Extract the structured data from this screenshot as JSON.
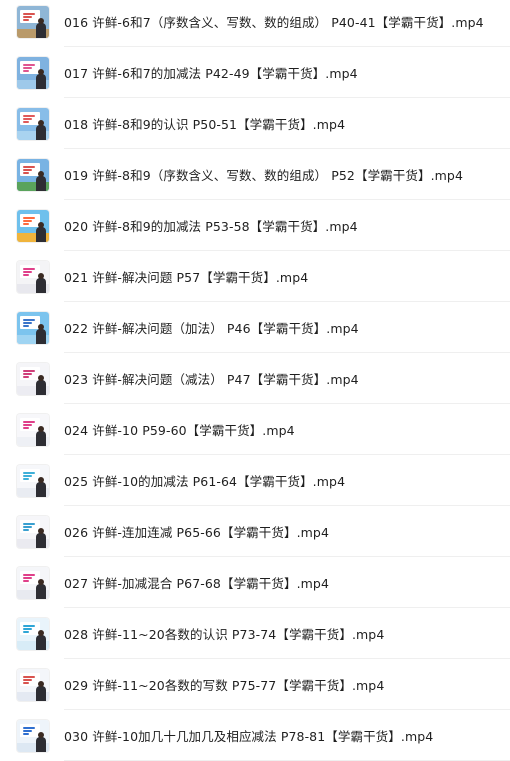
{
  "files": [
    {
      "name": "016 许鲜-6和7（序数含义、写数、数的组成） P40-41【学霸干货】.mp4",
      "thumb": {
        "sky": "#8fb6d6",
        "ground": "#b99a6a",
        "accent": "#d9534f"
      }
    },
    {
      "name": "017 许鲜-6和7的加减法 P42-49【学霸干货】.mp4",
      "thumb": {
        "sky": "#7fb2e0",
        "ground": "#9ec9ea",
        "accent": "#e0558f"
      }
    },
    {
      "name": "018 许鲜-8和9的认识 P50-51【学霸干货】.mp4",
      "thumb": {
        "sky": "#88bde8",
        "ground": "#a9d3f0",
        "accent": "#e05a5a"
      }
    },
    {
      "name": "019 许鲜-8和9（序数含义、写数、数的组成） P52【学霸干货】.mp4",
      "thumb": {
        "sky": "#79b3e3",
        "ground": "#5aa35c",
        "accent": "#d9534f"
      }
    },
    {
      "name": "020 许鲜-8和9的加减法 P53-58【学霸干货】.mp4",
      "thumb": {
        "sky": "#6fc0ec",
        "ground": "#f0b43c",
        "accent": "#ff6a3d"
      }
    },
    {
      "name": "021 许鲜-解决问题 P57【学霸干货】.mp4",
      "thumb": {
        "sky": "#f4f4f6",
        "ground": "#e8e8ee",
        "accent": "#e0408a"
      }
    },
    {
      "name": "022 许鲜-解决问题（加法） P46【学霸干货】.mp4",
      "thumb": {
        "sky": "#7cc4ee",
        "ground": "#9fd4f2",
        "accent": "#3a74c9"
      }
    },
    {
      "name": "023 许鲜-解决问题（减法） P47【学霸干货】.mp4",
      "thumb": {
        "sky": "#f5f5f8",
        "ground": "#ececf2",
        "accent": "#d0407a"
      }
    },
    {
      "name": "024 许鲜-10 P59-60【学霸干货】.mp4",
      "thumb": {
        "sky": "#f7f7fa",
        "ground": "#eef0f5",
        "accent": "#e0408a"
      }
    },
    {
      "name": "025 许鲜-10的加减法 P61-64【学霸干货】.mp4",
      "thumb": {
        "sky": "#f6f7fa",
        "ground": "#e9ecf2",
        "accent": "#3fb0d8"
      }
    },
    {
      "name": "026 许鲜-连加连减 P65-66【学霸干货】.mp4",
      "thumb": {
        "sky": "#f6f6f9",
        "ground": "#eaeaf0",
        "accent": "#3aa0d0"
      }
    },
    {
      "name": "027 许鲜-加减混合 P67-68【学霸干货】.mp4",
      "thumb": {
        "sky": "#f5f6f9",
        "ground": "#e8eaf0",
        "accent": "#e0408a"
      }
    },
    {
      "name": "028 许鲜-11~20各数的认识 P73-74【学霸干货】.mp4",
      "thumb": {
        "sky": "#e9f4fb",
        "ground": "#d8ecf7",
        "accent": "#2fa6d6"
      }
    },
    {
      "name": "029 许鲜-11~20各数的写数 P75-77【学霸干货】.mp4",
      "thumb": {
        "sky": "#f4f6fa",
        "ground": "#e4e9f2",
        "accent": "#d9534f"
      }
    },
    {
      "name": "030 许鲜-10加几十几加几及相应减法 P78-81【学霸干货】.mp4",
      "thumb": {
        "sky": "#eef4fa",
        "ground": "#dde8f3",
        "accent": "#2f6fd0"
      }
    }
  ]
}
